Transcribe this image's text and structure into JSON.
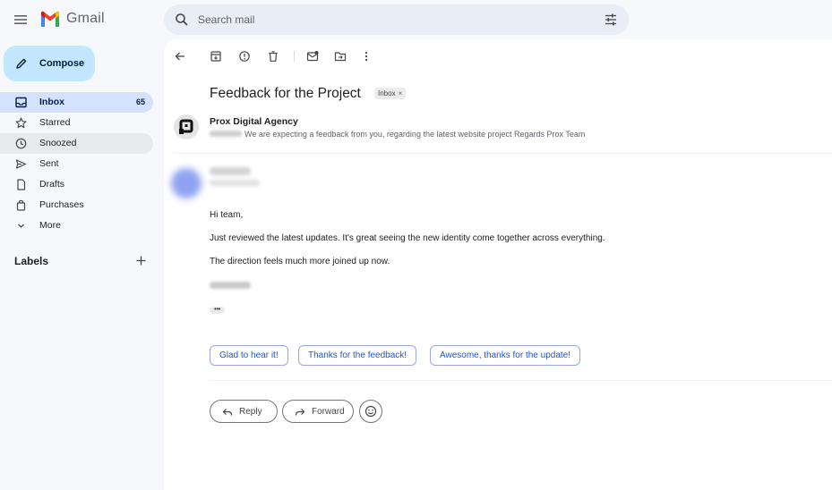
{
  "app": {
    "name": "Gmail"
  },
  "search": {
    "placeholder": "Search mail"
  },
  "sidebar": {
    "compose_label": "Compose",
    "items": [
      {
        "label": "Inbox",
        "count": "65",
        "icon": "inbox-icon"
      },
      {
        "label": "Starred",
        "icon": "star-icon"
      },
      {
        "label": "Snoozed",
        "icon": "clock-icon"
      },
      {
        "label": "Sent",
        "icon": "send-icon"
      },
      {
        "label": "Drafts",
        "icon": "draft-icon"
      },
      {
        "label": "Purchases",
        "icon": "bag-icon"
      },
      {
        "label": "More",
        "icon": "chevron-down-icon"
      }
    ],
    "labels_title": "Labels"
  },
  "email": {
    "subject": "Feedback for the Project",
    "chip": "Inbox",
    "thread": {
      "sender": "Prox Digital Agency",
      "snippet": "We are expecting a feedback from you, regarding the latest website project Regards Prox Team"
    },
    "message": {
      "greeting": "Hi team,",
      "line1": "Just reviewed the latest updates. It's great seeing the new identity come together across everything.",
      "line2": "The direction feels much more joined up now.",
      "ellipsis": "•••"
    },
    "smart_replies": [
      "Glad to hear it!",
      "Thanks for the feedback!",
      "Awesome, thanks for the update!"
    ],
    "actions": {
      "reply": "Reply",
      "forward": "Forward"
    }
  },
  "colors": {
    "background": "#f6f8fc",
    "compose": "#c2e7ff",
    "active_nav": "#d3e3fd",
    "link": "#1a56d6"
  }
}
